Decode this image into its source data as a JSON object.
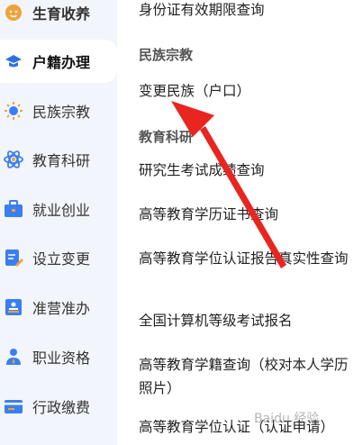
{
  "sidebar": {
    "items": [
      {
        "label": "生育收养",
        "icon": "baby-icon"
      },
      {
        "label": "户籍办理",
        "icon": "id-cap-icon"
      },
      {
        "label": "民族宗教",
        "icon": "temple-icon"
      },
      {
        "label": "教育科研",
        "icon": "atom-icon"
      },
      {
        "label": "就业创业",
        "icon": "briefcase-icon"
      },
      {
        "label": "设立变更",
        "icon": "edit-doc-icon"
      },
      {
        "label": "准营准办",
        "icon": "stamp-icon"
      },
      {
        "label": "职业资格",
        "icon": "person-badge-icon"
      },
      {
        "label": "行政缴费",
        "icon": "wallet-icon"
      }
    ],
    "active_index": 1
  },
  "content": {
    "top_item": "身份证有效期限查询",
    "sections": [
      {
        "title": "民族宗教",
        "items": [
          "变更民族（户口）"
        ]
      },
      {
        "title": "教育科研",
        "items": [
          "研究生考试成绩查询",
          "高等教育学历证书查询",
          "高等教育学位认证报告真实性查询",
          "全国计算机等级考试报名",
          "高等教育学籍查询（校对本人学历照片）",
          "高等教育学位认证（认证申请）"
        ]
      }
    ]
  },
  "watermark": "Baidu 经验",
  "colors": {
    "accent": "#2f6fe0",
    "arrow": "#e8251f",
    "sidebar_bg": "#f2f5fb"
  }
}
